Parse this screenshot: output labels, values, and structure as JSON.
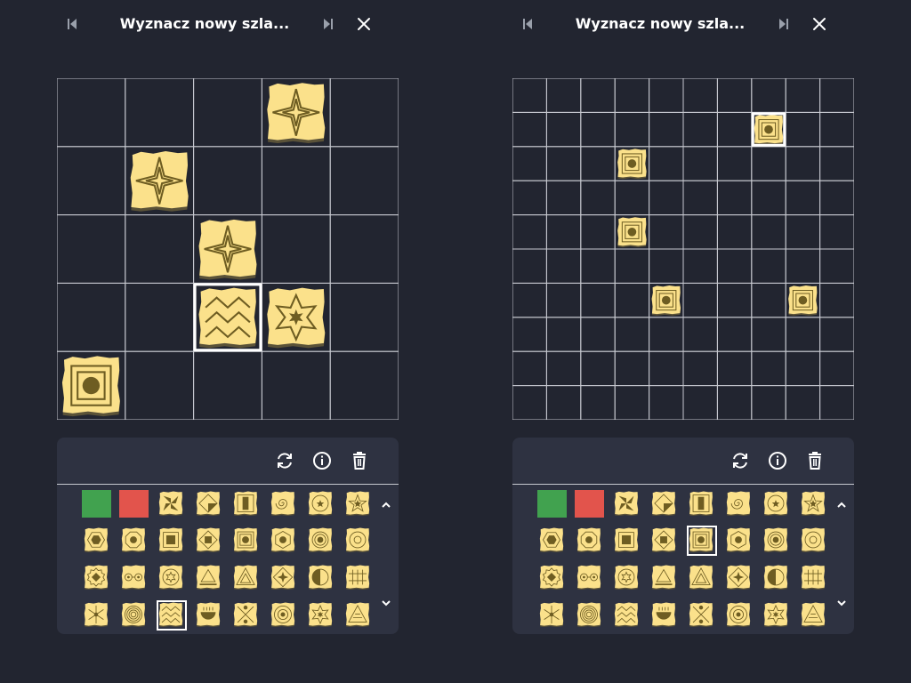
{
  "colors": {
    "background": "#222530",
    "palette_background": "#2e3241",
    "grid_line": "#c6c8cf",
    "tile_fill": "#fbe18b",
    "tile_symbol": "#6e5d22",
    "swatch_green": "#41a24f",
    "swatch_red": "#e2544c",
    "selection": "#ffffff"
  },
  "panels": [
    {
      "id": "left",
      "title": "Wyznacz nowy szla...",
      "icons": {
        "prev": "skip-previous-icon",
        "next": "skip-next-icon",
        "close": "close-icon",
        "rotate": "rotate-icon",
        "info": "info-icon",
        "delete": "trash-icon",
        "scroll_up": "chevron-up-icon",
        "scroll_down": "chevron-down-icon"
      },
      "board": {
        "cols": 5,
        "rows": 5,
        "pieces": [
          {
            "col": 3,
            "row": 0,
            "symbol": "star4"
          },
          {
            "col": 1,
            "row": 1,
            "symbol": "star4"
          },
          {
            "col": 2,
            "row": 2,
            "symbol": "star4"
          },
          {
            "col": 2,
            "row": 3,
            "symbol": "waves",
            "selected": true
          },
          {
            "col": 3,
            "row": 3,
            "symbol": "star6"
          },
          {
            "col": 0,
            "row": 4,
            "symbol": "square-dot"
          }
        ]
      },
      "palette": {
        "swatches": [
          "green",
          "red"
        ],
        "selected": "3-2",
        "rows": [
          [
            "pinwheel",
            "diamond-tilt",
            "pillar",
            "spiral",
            "circle-star",
            "star5"
          ],
          [
            "hexagon",
            "octagon",
            "square",
            "diamond-square",
            "square-dot",
            "hex-dot",
            "circle-dot",
            "circle-ring"
          ],
          [
            "sun-gear",
            "eyes",
            "circle-star6",
            "triangle-bar",
            "triangle-nested",
            "diamond-star",
            "half-circle",
            "bars"
          ],
          [
            "swirl",
            "rings",
            "waves",
            "bowl",
            "cross-circles",
            "target",
            "star6",
            "triangle-lines"
          ]
        ]
      }
    },
    {
      "id": "right",
      "title": "Wyznacz nowy szla...",
      "icons": {
        "prev": "skip-previous-icon",
        "next": "skip-next-icon",
        "close": "close-icon",
        "rotate": "rotate-icon",
        "info": "info-icon",
        "delete": "trash-icon",
        "scroll_up": "chevron-up-icon",
        "scroll_down": "chevron-down-icon"
      },
      "board": {
        "cols": 10,
        "rows": 10,
        "pieces": [
          {
            "col": 7,
            "row": 1,
            "symbol": "square-dot",
            "selected": true
          },
          {
            "col": 3,
            "row": 2,
            "symbol": "square-dot"
          },
          {
            "col": 3,
            "row": 4,
            "symbol": "square-dot"
          },
          {
            "col": 4,
            "row": 6,
            "symbol": "square-dot"
          },
          {
            "col": 8,
            "row": 6,
            "symbol": "square-dot"
          }
        ]
      },
      "palette": {
        "swatches": [
          "green",
          "red"
        ],
        "selected": "1-4",
        "rows": [
          [
            "pinwheel",
            "diamond-tilt",
            "pillar",
            "spiral",
            "circle-star",
            "star5"
          ],
          [
            "hexagon",
            "octagon",
            "square",
            "diamond-square",
            "square-dot",
            "hex-dot",
            "circle-dot",
            "circle-ring"
          ],
          [
            "sun-gear",
            "eyes",
            "circle-star6",
            "triangle-bar",
            "triangle-nested",
            "diamond-star",
            "half-circle",
            "bars"
          ],
          [
            "swirl",
            "rings",
            "waves",
            "bowl",
            "cross-circles",
            "target",
            "star6",
            "triangle-lines"
          ]
        ]
      }
    }
  ]
}
